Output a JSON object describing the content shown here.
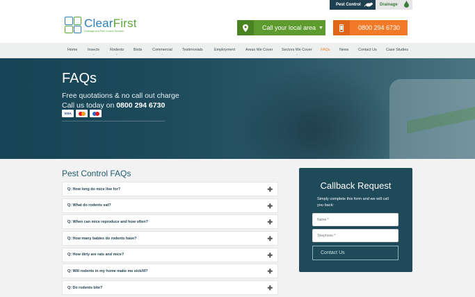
{
  "top_tabs": [
    {
      "label": "Pest Control",
      "icon": "rat-icon"
    },
    {
      "label": "Drainage",
      "icon": "droplet-icon"
    }
  ],
  "logo": {
    "name_part1": "Clear",
    "name_part2": "First",
    "tagline": "Drainage and Pest Control Services"
  },
  "header": {
    "local_area_label": "Call your local area",
    "phone_label": "0800 294 6730"
  },
  "nav": {
    "items": [
      {
        "label": "Home"
      },
      {
        "label": "Insects"
      },
      {
        "label": "Rodents"
      },
      {
        "label": "Birds"
      },
      {
        "label": "Commercial"
      },
      {
        "label": "Testimonials"
      },
      {
        "label": "Employment"
      },
      {
        "label": "Areas We Cover"
      },
      {
        "label": "Sectors We Cover"
      },
      {
        "label": "FAQs"
      },
      {
        "label": "News"
      },
      {
        "label": "Contact Us"
      },
      {
        "label": "Case Studies"
      }
    ],
    "active": "FAQs"
  },
  "hero": {
    "title": "FAQs",
    "subtitle": "Free quotations & no call out charge",
    "call_prefix": "Call us today on ",
    "call_number": "0800 294 6730",
    "cards": [
      "VISA",
      "mastercard",
      "maestro"
    ]
  },
  "faq": {
    "title": "Pest Control FAQs",
    "items": [
      "Q: How long do mice live for?",
      "Q: What do rodents eat?",
      "Q: When can mice reproduce and how often?",
      "Q: How many babies do rodents have?",
      "Q: How dirty are rats and mice?",
      "Q: Will rodents in my home make me sick/ill?",
      "Q: Do rodents bite?"
    ]
  },
  "callback": {
    "title": "Callback Request",
    "text": "Simply complete this form and we will call you back:",
    "name_placeholder": "Name *",
    "phone_placeholder": "Telephone *",
    "button": "Contact Us"
  },
  "colors": {
    "dark_teal": "#1e4a5a",
    "green": "#5e9b2e",
    "orange": "#f07a28"
  }
}
